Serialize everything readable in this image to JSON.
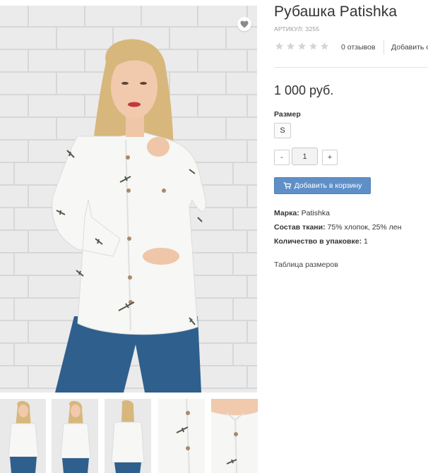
{
  "product": {
    "title": "Рубашка Patishka",
    "sku_label": "АРТИКУЛ: 3255",
    "reviews": "0 отзывов",
    "add_review": "Добавить отзыв",
    "price": "1 000 руб.",
    "size_label": "Размер",
    "size_option": "S",
    "qty_minus": "-",
    "qty_value": "1",
    "qty_plus": "+",
    "cart_button": "Добавить в корзину",
    "rating_stars": 0,
    "props": [
      {
        "label": "Марка:",
        "value": "Patishka"
      },
      {
        "label": "Состав ткани:",
        "value": "75% хлопок, 25% лен"
      },
      {
        "label": "Количество в упаковке:",
        "value": "1"
      }
    ],
    "size_table": "Таблица размеров"
  },
  "icons": {
    "favorite": "heart-icon",
    "star": "star-icon",
    "cart": "cart-icon"
  },
  "colors": {
    "cart_button": "#5f8fc7",
    "star_empty": "#d4d4d4",
    "brick": "#e9e9e9",
    "jeans": "#2f5f8c"
  }
}
